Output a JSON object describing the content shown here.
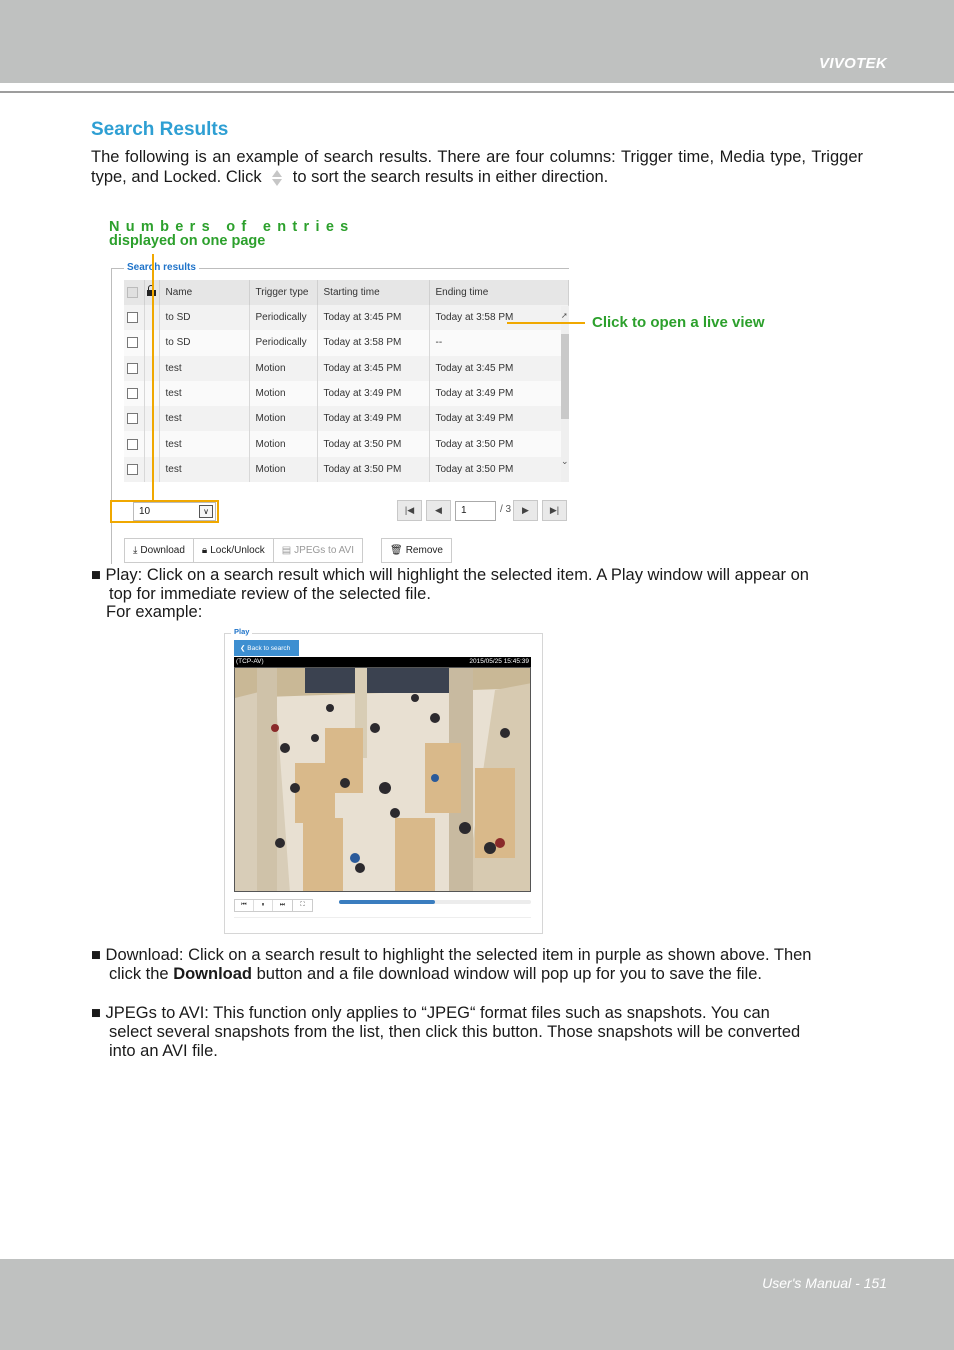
{
  "header": {
    "brand": "VIVOTEK"
  },
  "footer": {
    "page_label": "User's Manual - 151"
  },
  "section": {
    "title": "Search Results",
    "intro_before_icon": "The following is an example of search results. There are four columns: Trigger time, Media type, Trigger type, and Locked. Click",
    "intro_icon": "sort-arrows-icon",
    "intro_after_icon": "to sort the search results in either direction."
  },
  "annotations": {
    "entries_line1": "Numbers of entries",
    "entries_line2": "displayed on one page",
    "live_view": "Click to open a live view",
    "accent_color": "#2ca02c",
    "leader_color": "#f0a800"
  },
  "search_panel": {
    "legend": "Search results",
    "columns": [
      "",
      "",
      "Name",
      "Trigger type",
      "Starting time",
      "Ending time"
    ],
    "rows": [
      {
        "name": "to SD",
        "trigger": "Periodically",
        "start": "Today at 3:45 PM",
        "end": "Today at 3:58 PM"
      },
      {
        "name": "to SD",
        "trigger": "Periodically",
        "start": "Today at 3:58 PM",
        "end": "--"
      },
      {
        "name": "test",
        "trigger": "Motion",
        "start": "Today at 3:45 PM",
        "end": "Today at 3:45 PM"
      },
      {
        "name": "test",
        "trigger": "Motion",
        "start": "Today at 3:49 PM",
        "end": "Today at 3:49 PM"
      },
      {
        "name": "test",
        "trigger": "Motion",
        "start": "Today at 3:49 PM",
        "end": "Today at 3:49 PM"
      },
      {
        "name": "test",
        "trigger": "Motion",
        "start": "Today at 3:50 PM",
        "end": "Today at 3:50 PM"
      },
      {
        "name": "test",
        "trigger": "Motion",
        "start": "Today at 3:50 PM",
        "end": "Today at 3:50 PM"
      }
    ],
    "per_page_value": "10",
    "pager": {
      "current_page": "1",
      "total_label": "/ 3"
    },
    "actions": {
      "download": "Download",
      "lock_unlock": "Lock/Unlock",
      "jpegs_to_avi": "JPEGs to AVI",
      "remove": "Remove"
    }
  },
  "bullets": {
    "play": "■ Play: Click on a search result which will highlight the selected item. A Play window will appear on",
    "play_cont": "top for immediate review of the selected file.",
    "for_example": "For example:",
    "download_a": "■ Download: Click on a search result to highlight the selected item in purple as shown above. Then",
    "download_b_pre": "click the ",
    "download_b_bold": "Download",
    "download_b_post": " button and a file download window will pop up for you to save the file.",
    "jpegs_a": "■ JPEGs to AVI: This function only applies to “JPEG“ format files such as snapshots. You can",
    "jpegs_b": "select several snapshots from the list, then click this button. Those snapshots will be converted",
    "jpegs_c": "into an AVI file."
  },
  "play_panel": {
    "legend": "Play",
    "back_button": "❮ Back to search",
    "stream_label": "(TCP-AV)",
    "timestamp": "2015/05/25 15:45:39",
    "video_description": "Overhead view of a crowded retail store with display tables",
    "controls": [
      "previous-icon",
      "pause-icon",
      "next-icon",
      "fullscreen-icon"
    ],
    "progress_fraction": 0.5,
    "progress_color": "#3a7dbf"
  }
}
